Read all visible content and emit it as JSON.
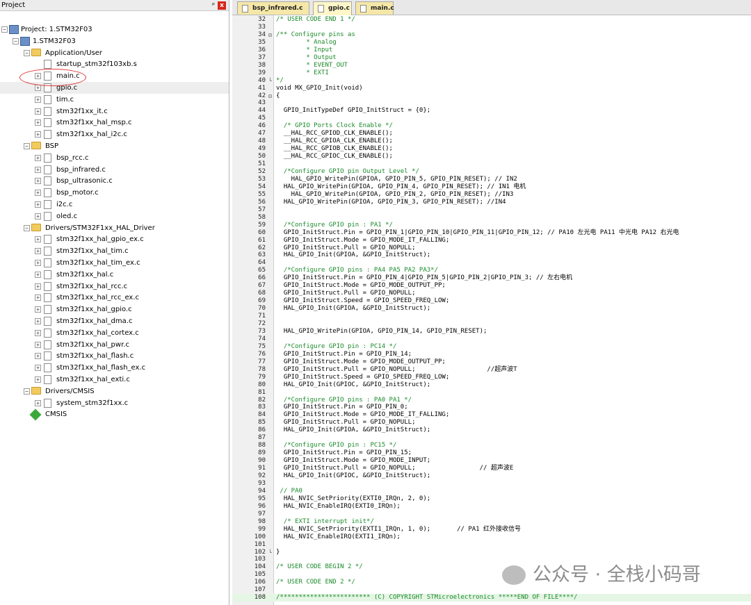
{
  "project_panel": {
    "title": "Project",
    "pin": "ᵖ",
    "close": "x"
  },
  "tree": [
    {
      "label": "Project: 1.STM32F03",
      "icon": "project-icon",
      "expander": "−",
      "level": 0
    },
    {
      "label": "1.STM32F03",
      "icon": "target-icon",
      "expander": "−",
      "level": 1
    },
    {
      "label": "Application/User",
      "icon": "folder-icon",
      "expander": "−",
      "level": 2
    },
    {
      "label": "startup_stm32f103xb.s",
      "icon": "file-icon",
      "expander": "",
      "level": 3
    },
    {
      "label": "main.c",
      "icon": "file-icon",
      "expander": "+",
      "level": 3
    },
    {
      "label": "gpio.c",
      "icon": "file-icon",
      "expander": "+",
      "level": 3,
      "selected": true
    },
    {
      "label": "tim.c",
      "icon": "file-icon",
      "expander": "+",
      "level": 3
    },
    {
      "label": "stm32f1xx_it.c",
      "icon": "file-icon",
      "expander": "+",
      "level": 3
    },
    {
      "label": "stm32f1xx_hal_msp.c",
      "icon": "file-icon",
      "expander": "+",
      "level": 3
    },
    {
      "label": "stm32f1xx_hal_i2c.c",
      "icon": "file-icon",
      "expander": "+",
      "level": 3
    },
    {
      "label": "BSP",
      "icon": "folder-icon",
      "expander": "−",
      "level": 2
    },
    {
      "label": "bsp_rcc.c",
      "icon": "file-icon",
      "expander": "+",
      "level": 3
    },
    {
      "label": "bsp_infrared.c",
      "icon": "file-icon",
      "expander": "+",
      "level": 3
    },
    {
      "label": "bsp_ultrasonic.c",
      "icon": "file-icon",
      "expander": "+",
      "level": 3
    },
    {
      "label": "bsp_motor.c",
      "icon": "file-icon",
      "expander": "+",
      "level": 3
    },
    {
      "label": "i2c.c",
      "icon": "file-icon",
      "expander": "+",
      "level": 3
    },
    {
      "label": "oled.c",
      "icon": "file-icon",
      "expander": "+",
      "level": 3
    },
    {
      "label": "Drivers/STM32F1xx_HAL_Driver",
      "icon": "folder-icon",
      "expander": "−",
      "level": 2
    },
    {
      "label": "stm32f1xx_hal_gpio_ex.c",
      "icon": "file-icon",
      "expander": "+",
      "level": 3
    },
    {
      "label": "stm32f1xx_hal_tim.c",
      "icon": "file-icon",
      "expander": "+",
      "level": 3
    },
    {
      "label": "stm32f1xx_hal_tim_ex.c",
      "icon": "file-icon",
      "expander": "+",
      "level": 3
    },
    {
      "label": "stm32f1xx_hal.c",
      "icon": "file-icon",
      "expander": "+",
      "level": 3
    },
    {
      "label": "stm32f1xx_hal_rcc.c",
      "icon": "file-icon",
      "expander": "+",
      "level": 3
    },
    {
      "label": "stm32f1xx_hal_rcc_ex.c",
      "icon": "file-icon",
      "expander": "+",
      "level": 3
    },
    {
      "label": "stm32f1xx_hal_gpio.c",
      "icon": "file-icon",
      "expander": "+",
      "level": 3
    },
    {
      "label": "stm32f1xx_hal_dma.c",
      "icon": "file-icon",
      "expander": "+",
      "level": 3
    },
    {
      "label": "stm32f1xx_hal_cortex.c",
      "icon": "file-icon",
      "expander": "+",
      "level": 3
    },
    {
      "label": "stm32f1xx_hal_pwr.c",
      "icon": "file-icon",
      "expander": "+",
      "level": 3
    },
    {
      "label": "stm32f1xx_hal_flash.c",
      "icon": "file-icon",
      "expander": "+",
      "level": 3
    },
    {
      "label": "stm32f1xx_hal_flash_ex.c",
      "icon": "file-icon",
      "expander": "+",
      "level": 3
    },
    {
      "label": "stm32f1xx_hal_exti.c",
      "icon": "file-icon",
      "expander": "+",
      "level": 3
    },
    {
      "label": "Drivers/CMSIS",
      "icon": "folder-icon",
      "expander": "−",
      "level": 2
    },
    {
      "label": "system_stm32f1xx.c",
      "icon": "file-icon",
      "expander": "+",
      "level": 3
    },
    {
      "label": "CMSIS",
      "icon": "cmsis-icon",
      "expander": "",
      "level": 2
    }
  ],
  "tabs": [
    {
      "label": "bsp_infrared.c",
      "active": false
    },
    {
      "label": "gpio.c",
      "active": true
    },
    {
      "label": "main.c",
      "active": false
    }
  ],
  "code_lines": [
    {
      "n": "32",
      "t": "/* USER CODE END 1 */",
      "c": true
    },
    {
      "n": "33",
      "t": ""
    },
    {
      "n": "34",
      "t": "/** Configure pins as",
      "c": true,
      "f": "⊟"
    },
    {
      "n": "35",
      "t": "        * Analog",
      "c": true
    },
    {
      "n": "36",
      "t": "        * Input",
      "c": true
    },
    {
      "n": "37",
      "t": "        * Output",
      "c": true
    },
    {
      "n": "38",
      "t": "        * EVENT_OUT",
      "c": true
    },
    {
      "n": "39",
      "t": "        * EXTI",
      "c": true
    },
    {
      "n": "40",
      "t": "*/",
      "c": true,
      "f": "└"
    },
    {
      "n": "41",
      "t": "void MX_GPIO_Init(void)"
    },
    {
      "n": "42",
      "t": "{",
      "f": "⊟"
    },
    {
      "n": "43",
      "t": ""
    },
    {
      "n": "44",
      "t": "  GPIO_InitTypeDef GPIO_InitStruct = {0};"
    },
    {
      "n": "45",
      "t": ""
    },
    {
      "n": "46",
      "t": "  /* GPIO Ports Clock Enable */",
      "c": true
    },
    {
      "n": "47",
      "t": "  __HAL_RCC_GPIOD_CLK_ENABLE();"
    },
    {
      "n": "48",
      "t": "  __HAL_RCC_GPIOA_CLK_ENABLE();"
    },
    {
      "n": "49",
      "t": "  __HAL_RCC_GPIOB_CLK_ENABLE();"
    },
    {
      "n": "50",
      "t": "  __HAL_RCC_GPIOC_CLK_ENABLE();"
    },
    {
      "n": "51",
      "t": ""
    },
    {
      "n": "52",
      "t": "  /*Configure GPIO pin Output Level */",
      "c": true
    },
    {
      "n": "53",
      "t": "    HAL_GPIO_WritePin(GPIOA, GPIO_PIN_5, GPIO_PIN_RESET); // IN2"
    },
    {
      "n": "54",
      "t": "  HAL_GPIO_WritePin(GPIOA, GPIO_PIN_4, GPIO_PIN_RESET); // IN1 电机"
    },
    {
      "n": "55",
      "t": "    HAL_GPIO_WritePin(GPIOA, GPIO_PIN_2, GPIO_PIN_RESET); //IN3"
    },
    {
      "n": "56",
      "t": "  HAL_GPIO_WritePin(GPIOA, GPIO_PIN_3, GPIO_PIN_RESET); //IN4"
    },
    {
      "n": "57",
      "t": ""
    },
    {
      "n": "58",
      "t": ""
    },
    {
      "n": "59",
      "t": "  /*Configure GPIO pin : PA1 */",
      "c": true
    },
    {
      "n": "60",
      "t": "  GPIO_InitStruct.Pin = GPIO_PIN_1|GPIO_PIN_10|GPIO_PIN_11|GPIO_PIN_12; // PA10 左光电 PA11 中光电 PA12 右光电"
    },
    {
      "n": "61",
      "t": "  GPIO_InitStruct.Mode = GPIO_MODE_IT_FALLING;"
    },
    {
      "n": "62",
      "t": "  GPIO_InitStruct.Pull = GPIO_NOPULL;"
    },
    {
      "n": "63",
      "t": "  HAL_GPIO_Init(GPIOA, &GPIO_InitStruct);"
    },
    {
      "n": "64",
      "t": ""
    },
    {
      "n": "65",
      "t": "  /*Configure GPIO pins : PA4 PA5 PA2 PA3*/",
      "c": true
    },
    {
      "n": "66",
      "t": "  GPIO_InitStruct.Pin = GPIO_PIN_4|GPIO_PIN_5|GPIO_PIN_2|GPIO_PIN_3; // 左右电机"
    },
    {
      "n": "67",
      "t": "  GPIO_InitStruct.Mode = GPIO_MODE_OUTPUT_PP;"
    },
    {
      "n": "68",
      "t": "  GPIO_InitStruct.Pull = GPIO_NOPULL;"
    },
    {
      "n": "69",
      "t": "  GPIO_InitStruct.Speed = GPIO_SPEED_FREQ_LOW;"
    },
    {
      "n": "70",
      "t": "  HAL_GPIO_Init(GPIOA, &GPIO_InitStruct);"
    },
    {
      "n": "71",
      "t": ""
    },
    {
      "n": "72",
      "t": ""
    },
    {
      "n": "73",
      "t": "  HAL_GPIO_WritePin(GPIOA, GPIO_PIN_14, GPIO_PIN_RESET);"
    },
    {
      "n": "74",
      "t": ""
    },
    {
      "n": "75",
      "t": "  /*Configure GPIO pin : PC14 */",
      "c": true
    },
    {
      "n": "76",
      "t": "  GPIO_InitStruct.Pin = GPIO_PIN_14;"
    },
    {
      "n": "77",
      "t": "  GPIO_InitStruct.Mode = GPIO_MODE_OUTPUT_PP;"
    },
    {
      "n": "78",
      "t": "  GPIO_InitStruct.Pull = GPIO_NOPULL;                   //超声波T"
    },
    {
      "n": "79",
      "t": "  GPIO_InitStruct.Speed = GPIO_SPEED_FREQ_LOW;"
    },
    {
      "n": "80",
      "t": "  HAL_GPIO_Init(GPIOC, &GPIO_InitStruct);"
    },
    {
      "n": "81",
      "t": ""
    },
    {
      "n": "82",
      "t": "  /*Configure GPIO pins : PA0 PA1 */",
      "c": true
    },
    {
      "n": "83",
      "t": "  GPIO_InitStruct.Pin = GPIO_PIN_0;"
    },
    {
      "n": "84",
      "t": "  GPIO_InitStruct.Mode = GPIO_MODE_IT_FALLING;"
    },
    {
      "n": "85",
      "t": "  GPIO_InitStruct.Pull = GPIO_NOPULL;"
    },
    {
      "n": "86",
      "t": "  HAL_GPIO_Init(GPIOA, &GPIO_InitStruct);"
    },
    {
      "n": "87",
      "t": ""
    },
    {
      "n": "88",
      "t": "  /*Configure GPIO pin : PC15 */",
      "c": true
    },
    {
      "n": "89",
      "t": "  GPIO_InitStruct.Pin = GPIO_PIN_15;"
    },
    {
      "n": "90",
      "t": "  GPIO_InitStruct.Mode = GPIO_MODE_INPUT;"
    },
    {
      "n": "91",
      "t": "  GPIO_InitStruct.Pull = GPIO_NOPULL;                 // 超声波E"
    },
    {
      "n": "92",
      "t": "  HAL_GPIO_Init(GPIOC, &GPIO_InitStruct);"
    },
    {
      "n": "93",
      "t": ""
    },
    {
      "n": "94",
      "t": " // PA0",
      "c": true
    },
    {
      "n": "95",
      "t": "  HAL_NVIC_SetPriority(EXTI0_IRQn, 2, 0);"
    },
    {
      "n": "96",
      "t": "  HAL_NVIC_EnableIRQ(EXTI0_IRQn);"
    },
    {
      "n": "97",
      "t": ""
    },
    {
      "n": "98",
      "t": "  /* EXTI interrupt init*/",
      "c": true
    },
    {
      "n": "99",
      "t": "  HAL_NVIC_SetPriority(EXTI1_IRQn, 1, 0);       // PA1 红外接收信号"
    },
    {
      "n": "100",
      "t": "  HAL_NVIC_EnableIRQ(EXTI1_IRQn);"
    },
    {
      "n": "101",
      "t": ""
    },
    {
      "n": "102",
      "t": "}",
      "f": "└"
    },
    {
      "n": "103",
      "t": ""
    },
    {
      "n": "104",
      "t": "/* USER CODE BEGIN 2 */",
      "c": true
    },
    {
      "n": "105",
      "t": ""
    },
    {
      "n": "106",
      "t": "/* USER CODE END 2 */",
      "c": true
    },
    {
      "n": "107",
      "t": ""
    },
    {
      "n": "108",
      "t": "/************************ (C) COPYRIGHT STMicroelectronics *****END OF FILE****/",
      "c": true,
      "hl": true
    }
  ],
  "watermark": "公众号 · 全栈小码哥",
  "colors": {
    "comment": "#1a8a2a",
    "tab": "#f5e7a8",
    "selection_circle": "#e03a3a"
  }
}
